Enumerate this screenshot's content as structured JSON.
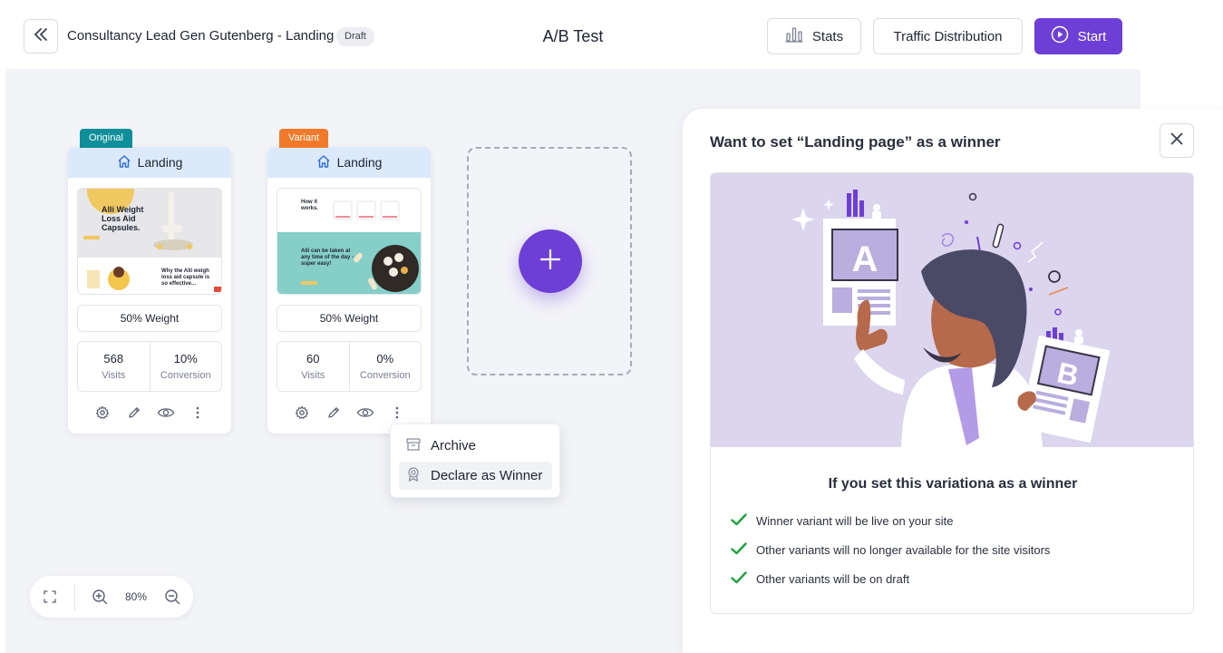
{
  "header": {
    "page_name": "Consultancy Lead Gen Gutenberg - Landing",
    "status_badge": "Draft",
    "title": "A/B Test",
    "stats_label": "Stats",
    "traffic_label": "Traffic Distribution",
    "start_label": "Start"
  },
  "cards": [
    {
      "tag": "Original",
      "tag_color": "#0e8f99",
      "title": "Landing",
      "weight": "50% Weight",
      "visits_value": "568",
      "visits_label": "Visits",
      "conversion_value": "10%",
      "conversion_label": "Conversion",
      "thumb": {
        "headline": "Alli Weight Loss Aid Capsules.",
        "subtext": "Why the Alli weigh loss aid capsule is so effective..."
      }
    },
    {
      "tag": "Variant",
      "tag_color": "#f07a2a",
      "title": "Landing",
      "weight": "50% Weight",
      "visits_value": "60",
      "visits_label": "Visits",
      "conversion_value": "0%",
      "conversion_label": "Conversion",
      "thumb": {
        "headline": "How it works.",
        "subtext": "Alli can be taken at any time of the day - super easy!"
      }
    }
  ],
  "context_menu": {
    "archive": "Archive",
    "declare_winner": "Declare as Winner"
  },
  "zoom": {
    "level": "80%"
  },
  "panel": {
    "title": "Want to set “Landing page” as a winner",
    "info_title": "If you set this variationa as a winner",
    "checks": [
      "Winner variant will be live on your site",
      "Other variants will no longer available for the site visitors",
      "Other variants will be on draft"
    ]
  },
  "colors": {
    "accent": "#6d3fd6",
    "check": "#1aa33a",
    "illustration_bg": "#dcd5ee"
  },
  "icons": [
    "double-chevron-left-icon",
    "bar-chart-icon",
    "play-circle-icon",
    "home-icon",
    "gear-icon",
    "pencil-icon",
    "eye-icon",
    "kebab-icon",
    "plus-icon",
    "archive-icon",
    "award-icon",
    "fullscreen-icon",
    "zoom-in-icon",
    "zoom-out-icon",
    "close-icon",
    "check-icon"
  ]
}
